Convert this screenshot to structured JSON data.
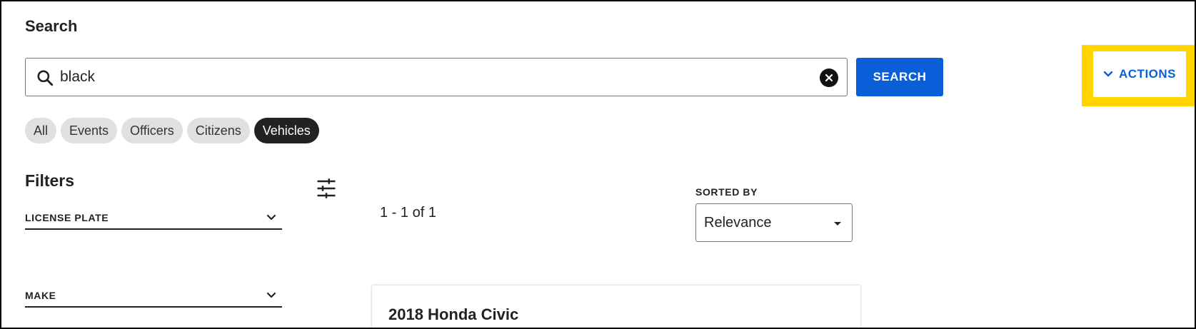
{
  "page": {
    "title": "Search"
  },
  "search": {
    "value": "black",
    "placeholder": "",
    "button_label": "SEARCH",
    "icon": "search-icon",
    "clear_icon": "clear-icon"
  },
  "actions": {
    "label": "ACTIONS",
    "icon": "chevron-down-icon",
    "highlight_color": "#ffd400"
  },
  "chips": [
    {
      "label": "All",
      "active": false
    },
    {
      "label": "Events",
      "active": false
    },
    {
      "label": "Officers",
      "active": false
    },
    {
      "label": "Citizens",
      "active": false
    },
    {
      "label": "Vehicles",
      "active": true
    }
  ],
  "filters": {
    "title": "Filters",
    "items": [
      {
        "label": "LICENSE PLATE"
      },
      {
        "label": "MAKE"
      }
    ]
  },
  "results": {
    "count_text": "1 - 1 of 1",
    "sorted_by_label": "SORTED BY",
    "sort_value": "Relevance",
    "items": [
      {
        "title": "2018 Honda Civic"
      }
    ]
  },
  "colors": {
    "accent": "#0a5fd8",
    "chip_active": "#222222",
    "chip_inactive": "#e0e0e0"
  }
}
